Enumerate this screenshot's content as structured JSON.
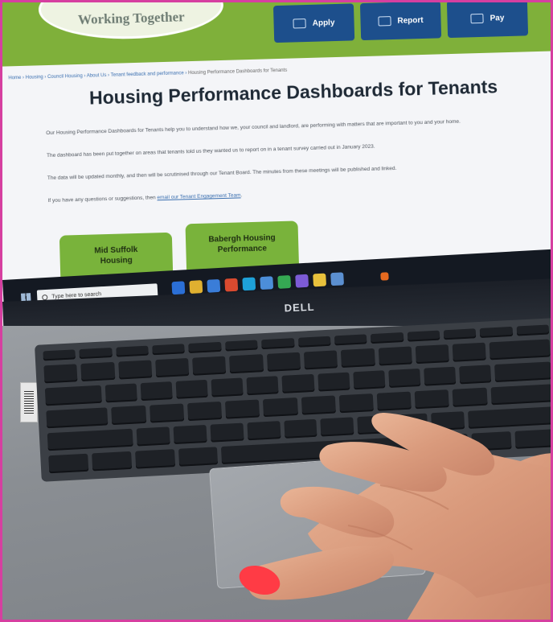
{
  "site": {
    "logo_text": "Working Together",
    "header_buttons": [
      {
        "label": "Apply",
        "icon": "form-icon"
      },
      {
        "label": "Report",
        "icon": "screen-icon"
      },
      {
        "label": "Pay",
        "icon": "card-icon"
      }
    ],
    "breadcrumb": [
      "Home",
      "Housing",
      "Council Housing",
      "About Us",
      "Tenant feedback and performance",
      "Housing Performance Dashboards for Tenants"
    ],
    "title": "Housing Performance Dashboards for Tenants",
    "paragraphs": [
      "Our Housing Performance Dashboards for Tenants help you to understand how we, your council and landlord, are performing with matters that are important to you and your home.",
      "The dashboard has been put together on areas that tenants told us they wanted us to report on in a tenant survey carried out in January 2023.",
      "The data will be updated monthly, and then will be scrutinised through our Tenant Board. The minutes from these meetings will be published and linked.",
      "If you have any questions or suggestions, then"
    ],
    "contact_link": "email our Tenant Engagement Team",
    "tiles": [
      {
        "line1": "Mid Suffolk",
        "line2": "Housing"
      },
      {
        "line1": "Babergh Housing",
        "line2": "Performance"
      }
    ]
  },
  "taskbar": {
    "search_placeholder": "Type here to search"
  },
  "laptop": {
    "brand": "DELL"
  },
  "colors": {
    "frame_border": "#d63fa0",
    "header_green": "#7fb03a",
    "button_blue": "#1d4f8c",
    "tile_green": "#79b33b",
    "nail": "#ff3b45"
  }
}
